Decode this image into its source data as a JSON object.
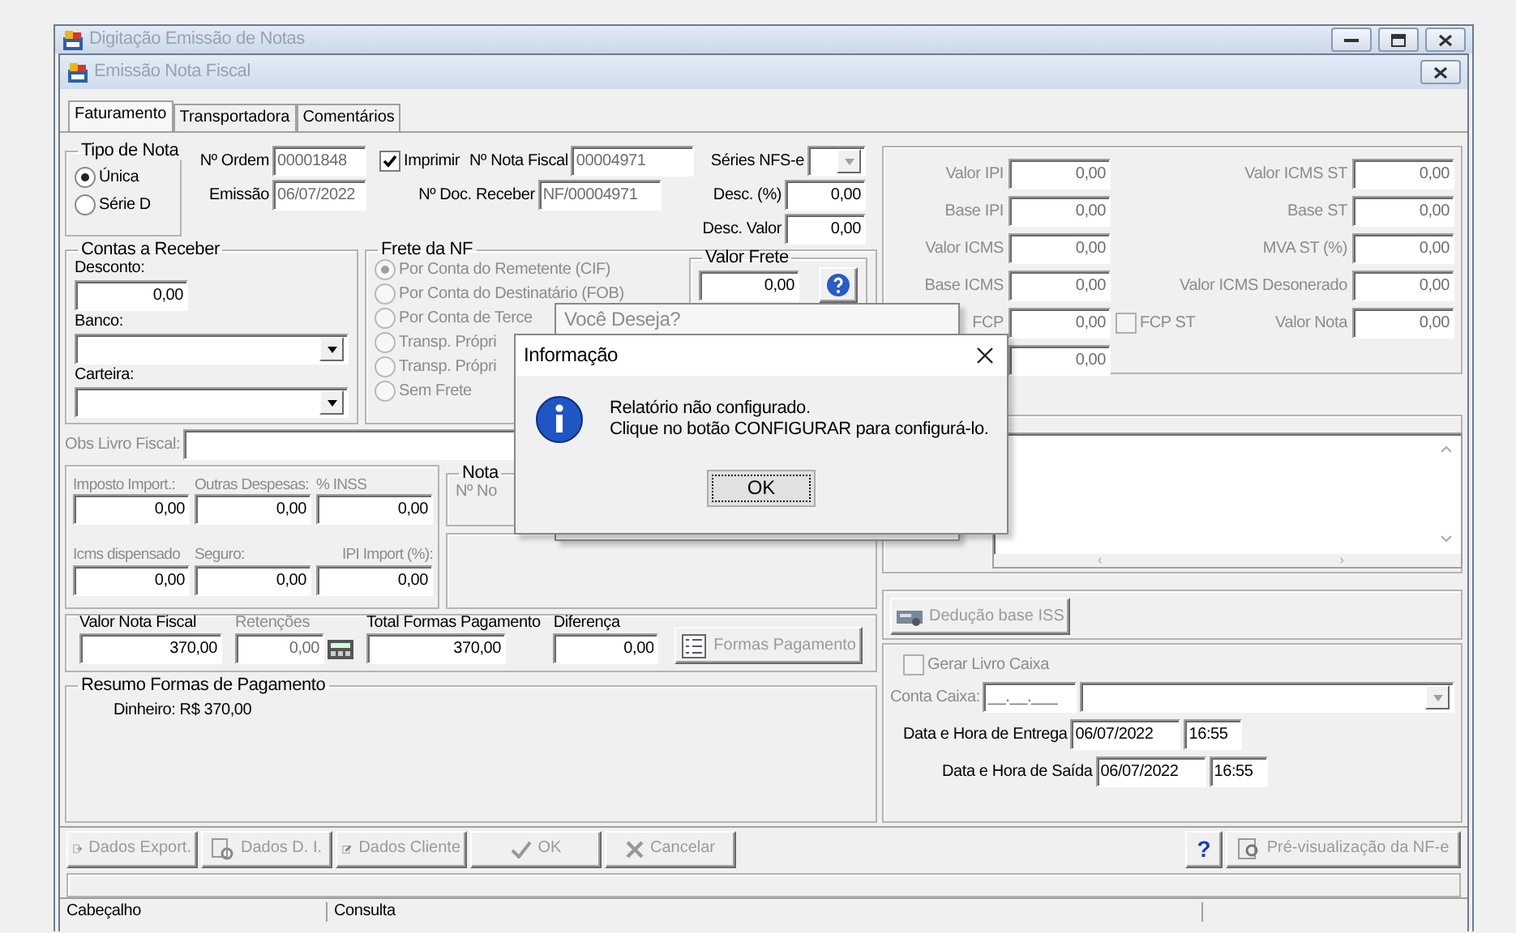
{
  "outer_window": {
    "title": "Digitação Emissão de Notas"
  },
  "window": {
    "title": "Emissão Nota Fiscal"
  },
  "tabs": [
    {
      "label": "Faturamento",
      "selected": true
    },
    {
      "label": "Transportadora",
      "selected": false
    },
    {
      "label": "Comentários",
      "selected": false
    }
  ],
  "tipo_nota": {
    "title": "Tipo de Nota",
    "options": [
      {
        "label": "Única",
        "selected": true
      },
      {
        "label": "Série D",
        "selected": false
      }
    ]
  },
  "ordem": {
    "label": "Nº Ordem",
    "value": "00001848"
  },
  "imprimir": {
    "label": "Imprimir",
    "checked": true
  },
  "nota_fiscal": {
    "label": "Nº Nota Fiscal",
    "value": "00004971"
  },
  "series_nfse": {
    "label": "Séries NFS-e"
  },
  "emissao": {
    "label": "Emissão",
    "value": "06/07/2022"
  },
  "doc_receber": {
    "label": "Nº Doc. Receber",
    "value": "NF/00004971"
  },
  "desc_pct": {
    "label": "Desc. (%)",
    "value": "0,00"
  },
  "desc_valor": {
    "label": "Desc. Valor",
    "value": "0,00"
  },
  "contas_receber": {
    "title": "Contas a Receber",
    "desconto": {
      "label": "Desconto:",
      "value": "0,00"
    },
    "banco": {
      "label": "Banco:"
    },
    "carteira": {
      "label": "Carteira:"
    }
  },
  "frete": {
    "title": "Frete da NF",
    "options": [
      {
        "label": "Por Conta do Remetente (CIF)",
        "selected": true
      },
      {
        "label": "Por Conta do Destinatário (FOB)",
        "selected": false
      },
      {
        "label": "Por Conta de Terce",
        "selected": false
      },
      {
        "label": "Transp. Própri",
        "selected": false
      },
      {
        "label": "Transp. Própri",
        "selected": false
      },
      {
        "label": "Sem Frete",
        "selected": false
      }
    ],
    "valor_frete": {
      "title": "Valor Frete",
      "value": "0,00"
    }
  },
  "obs_livro_fiscal": {
    "label": "Obs Livro Fiscal:"
  },
  "importacao": {
    "fields": [
      {
        "label": "Imposto Import.:",
        "value": "0,00"
      },
      {
        "label": "Outras Despesas:",
        "value": "0,00"
      },
      {
        "label": "% INSS",
        "value": "0,00"
      },
      {
        "label": "Icms dispensado",
        "value": "0,00"
      },
      {
        "label": "Seguro:",
        "value": "0,00"
      },
      {
        "label": "IPI Import (%):",
        "value": "0,00"
      }
    ]
  },
  "nota_group": {
    "title": "Nota",
    "label": "Nº No"
  },
  "totais": {
    "fields": [
      {
        "label": "Valor Nota Fiscal",
        "value": "370,00",
        "disabled": false
      },
      {
        "label": "Retenções",
        "value": "0,00",
        "disabled": true
      },
      {
        "label": "Total Formas Pagamento",
        "value": "370,00",
        "disabled": false
      },
      {
        "label": "Diferença",
        "value": "0,00",
        "disabled": false
      }
    ],
    "formas_button": "Formas Pagamento"
  },
  "resumo": {
    "title": "Resumo Formas de Pagamento",
    "lines": [
      "Dinheiro: R$ 370,00"
    ]
  },
  "impostos": {
    "left": [
      {
        "label": "Valor IPI",
        "value": "0,00"
      },
      {
        "label": "Base IPI",
        "value": "0,00"
      },
      {
        "label": "Valor ICMS",
        "value": "0,00"
      },
      {
        "label": "Base ICMS",
        "value": "0,00"
      },
      {
        "label": "FCP",
        "value": "0,00"
      },
      {
        "value": "0,00"
      }
    ],
    "right": [
      {
        "label": "Valor ICMS ST",
        "value": "0,00"
      },
      {
        "label": "Base ST",
        "value": "0,00"
      },
      {
        "label": "MVA ST (%)",
        "value": "0,00"
      },
      {
        "label": "Valor ICMS Desonerado",
        "value": "0,00"
      },
      {
        "label": "Valor Nota",
        "value": "0,00"
      }
    ],
    "fcp_st": {
      "label": "FCP ST",
      "checked": false
    }
  },
  "deducao_button": "Dedução base ISS",
  "caixa": {
    "gerar": {
      "label": "Gerar Livro Caixa",
      "checked": false
    },
    "conta": {
      "label": "Conta Caixa:",
      "value": "__.__.___"
    },
    "entrega": {
      "label": "Data e Hora de Entrega",
      "date": "06/07/2022",
      "time": "16:55"
    },
    "saida": {
      "label": "Data e Hora de Saída",
      "date": "06/07/2022",
      "time": "16:55"
    }
  },
  "bottom_buttons": [
    {
      "label": "Dados Export.",
      "kind": "export",
      "disabled": true
    },
    {
      "label": "Dados D. I.",
      "kind": "di",
      "disabled": true
    },
    {
      "label": "Dados Cliente",
      "kind": "edit",
      "disabled": true
    },
    {
      "label": "OK",
      "kind": "ok",
      "disabled": true
    },
    {
      "label": "Cancelar",
      "kind": "cancel",
      "disabled": true
    }
  ],
  "right_buttons": [
    {
      "label": "?",
      "kind": "help",
      "disabled": false
    },
    {
      "label": "Pré-visualização da NF-e",
      "kind": "preview",
      "disabled": true
    }
  ],
  "status_bar": [
    "Cabeçalho",
    "Consulta"
  ],
  "back_dialog": {
    "title": "Você Deseja?"
  },
  "info_dialog": {
    "title": "Informação",
    "lines": [
      "Relatório não configurado.",
      "Clique no botão CONFIGURAR para configurá-lo."
    ],
    "button": "OK"
  }
}
